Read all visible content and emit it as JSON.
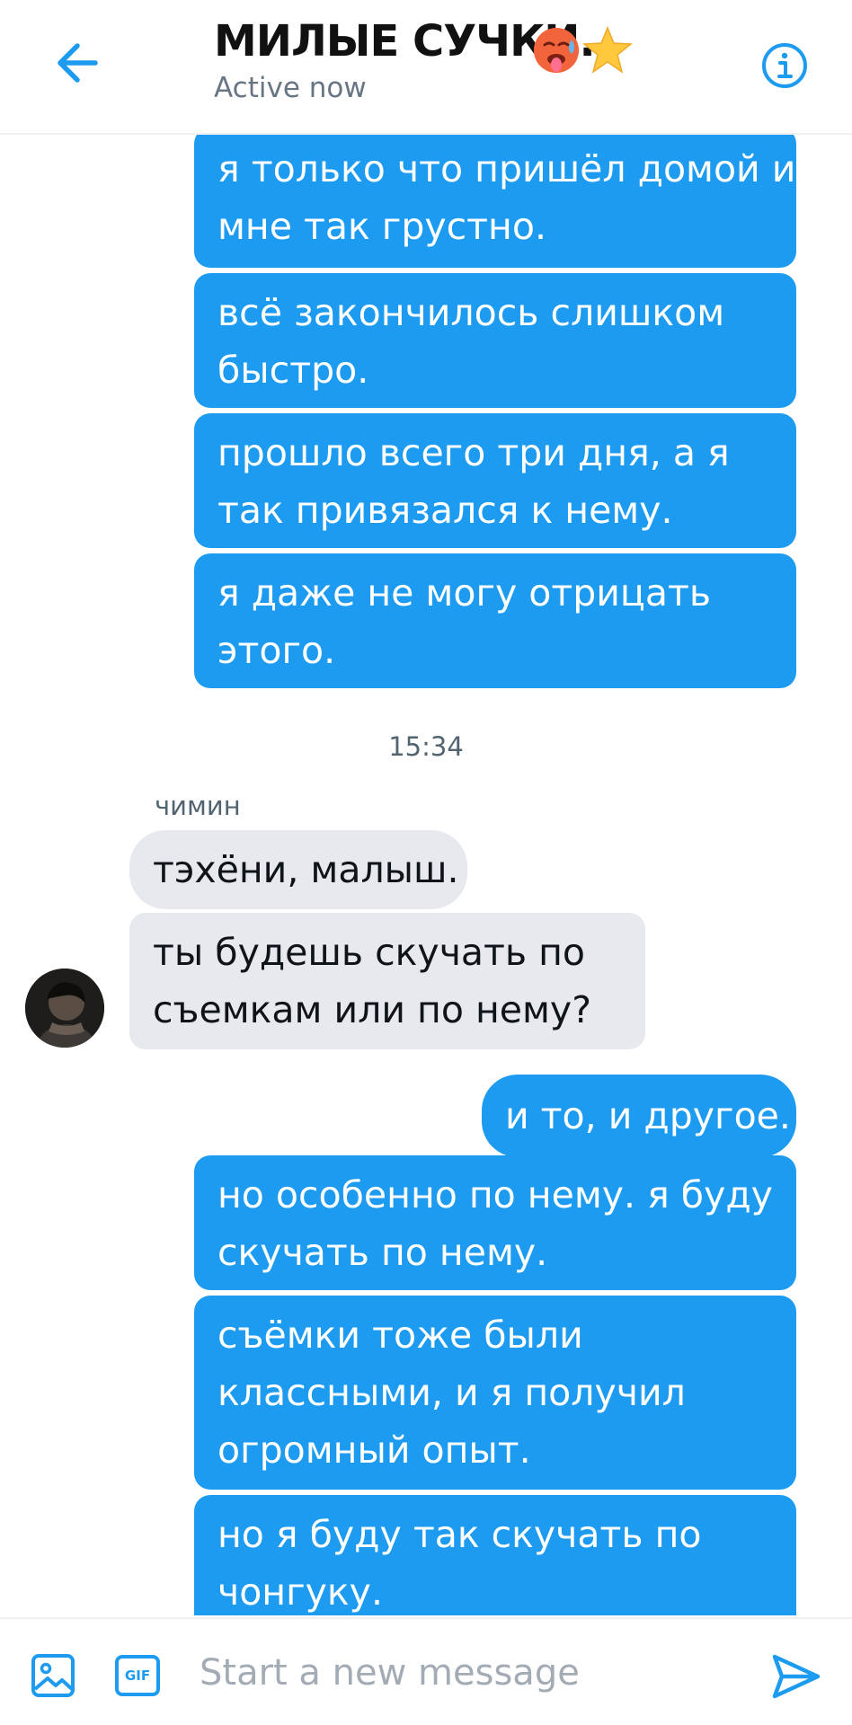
{
  "header": {
    "title": "МИЛЫЕ СУЧКИ.",
    "title_emojis": [
      "hot-face-emoji",
      "star-emoji"
    ],
    "status": "Active now",
    "back_icon": "arrow-left-icon",
    "info_icon": "info-circle-icon"
  },
  "messages_before": [
    {
      "lines": [
        "я только что пришёл домой и",
        "мне так грустно."
      ]
    },
    {
      "lines": [
        "всё закончилось слишком",
        "быстро."
      ]
    },
    {
      "lines": [
        "прошло всего три дня, а я",
        "так привязался к нему."
      ]
    },
    {
      "lines": [
        "я даже не могу отрицать",
        "этого."
      ]
    }
  ],
  "timestamp": "15:34",
  "incoming": {
    "sender": "чимин",
    "messages": [
      {
        "lines": [
          "тэхёни, малыш."
        ]
      },
      {
        "lines": [
          "ты будешь скучать по",
          "съемкам или по нему?"
        ]
      }
    ]
  },
  "messages_after": [
    {
      "lines": [
        "и то, и другое."
      ]
    },
    {
      "lines": [
        "но особенно по нему. я буду",
        "скучать по нему."
      ]
    },
    {
      "lines": [
        "съёмки тоже были",
        "классными, и я получил",
        "огромный опыт."
      ]
    },
    {
      "lines": [
        "но я буду так скучать по",
        "чонгуку."
      ]
    }
  ],
  "composer": {
    "placeholder": "Start a new message",
    "gif_label": "GIF",
    "image_icon": "image-icon",
    "send_icon": "send-icon"
  },
  "colors": {
    "accent": "#1d9bf0",
    "incoming_bubble": "#e7e9ee",
    "muted_text": "#536471"
  }
}
